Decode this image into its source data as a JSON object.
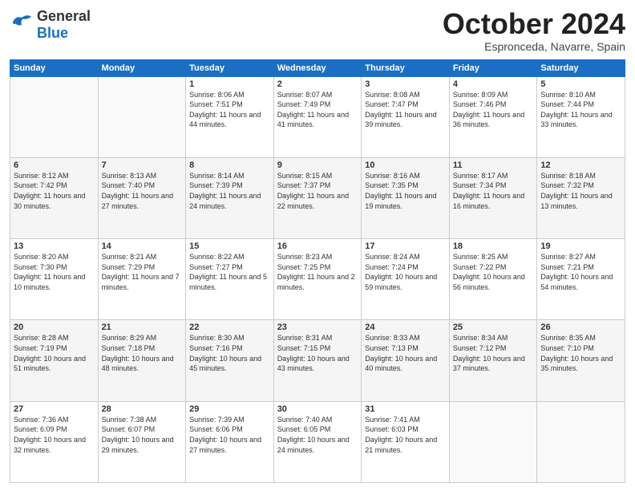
{
  "header": {
    "logo_line1": "General",
    "logo_line2": "Blue",
    "month": "October 2024",
    "location": "Espronceda, Navarre, Spain"
  },
  "days_of_week": [
    "Sunday",
    "Monday",
    "Tuesday",
    "Wednesday",
    "Thursday",
    "Friday",
    "Saturday"
  ],
  "weeks": [
    [
      {
        "day": "",
        "info": ""
      },
      {
        "day": "",
        "info": ""
      },
      {
        "day": "1",
        "info": "Sunrise: 8:06 AM\nSunset: 7:51 PM\nDaylight: 11 hours and 44 minutes."
      },
      {
        "day": "2",
        "info": "Sunrise: 8:07 AM\nSunset: 7:49 PM\nDaylight: 11 hours and 41 minutes."
      },
      {
        "day": "3",
        "info": "Sunrise: 8:08 AM\nSunset: 7:47 PM\nDaylight: 11 hours and 39 minutes."
      },
      {
        "day": "4",
        "info": "Sunrise: 8:09 AM\nSunset: 7:46 PM\nDaylight: 11 hours and 36 minutes."
      },
      {
        "day": "5",
        "info": "Sunrise: 8:10 AM\nSunset: 7:44 PM\nDaylight: 11 hours and 33 minutes."
      }
    ],
    [
      {
        "day": "6",
        "info": "Sunrise: 8:12 AM\nSunset: 7:42 PM\nDaylight: 11 hours and 30 minutes."
      },
      {
        "day": "7",
        "info": "Sunrise: 8:13 AM\nSunset: 7:40 PM\nDaylight: 11 hours and 27 minutes."
      },
      {
        "day": "8",
        "info": "Sunrise: 8:14 AM\nSunset: 7:39 PM\nDaylight: 11 hours and 24 minutes."
      },
      {
        "day": "9",
        "info": "Sunrise: 8:15 AM\nSunset: 7:37 PM\nDaylight: 11 hours and 22 minutes."
      },
      {
        "day": "10",
        "info": "Sunrise: 8:16 AM\nSunset: 7:35 PM\nDaylight: 11 hours and 19 minutes."
      },
      {
        "day": "11",
        "info": "Sunrise: 8:17 AM\nSunset: 7:34 PM\nDaylight: 11 hours and 16 minutes."
      },
      {
        "day": "12",
        "info": "Sunrise: 8:18 AM\nSunset: 7:32 PM\nDaylight: 11 hours and 13 minutes."
      }
    ],
    [
      {
        "day": "13",
        "info": "Sunrise: 8:20 AM\nSunset: 7:30 PM\nDaylight: 11 hours and 10 minutes."
      },
      {
        "day": "14",
        "info": "Sunrise: 8:21 AM\nSunset: 7:29 PM\nDaylight: 11 hours and 7 minutes."
      },
      {
        "day": "15",
        "info": "Sunrise: 8:22 AM\nSunset: 7:27 PM\nDaylight: 11 hours and 5 minutes."
      },
      {
        "day": "16",
        "info": "Sunrise: 8:23 AM\nSunset: 7:25 PM\nDaylight: 11 hours and 2 minutes."
      },
      {
        "day": "17",
        "info": "Sunrise: 8:24 AM\nSunset: 7:24 PM\nDaylight: 10 hours and 59 minutes."
      },
      {
        "day": "18",
        "info": "Sunrise: 8:25 AM\nSunset: 7:22 PM\nDaylight: 10 hours and 56 minutes."
      },
      {
        "day": "19",
        "info": "Sunrise: 8:27 AM\nSunset: 7:21 PM\nDaylight: 10 hours and 54 minutes."
      }
    ],
    [
      {
        "day": "20",
        "info": "Sunrise: 8:28 AM\nSunset: 7:19 PM\nDaylight: 10 hours and 51 minutes."
      },
      {
        "day": "21",
        "info": "Sunrise: 8:29 AM\nSunset: 7:18 PM\nDaylight: 10 hours and 48 minutes."
      },
      {
        "day": "22",
        "info": "Sunrise: 8:30 AM\nSunset: 7:16 PM\nDaylight: 10 hours and 45 minutes."
      },
      {
        "day": "23",
        "info": "Sunrise: 8:31 AM\nSunset: 7:15 PM\nDaylight: 10 hours and 43 minutes."
      },
      {
        "day": "24",
        "info": "Sunrise: 8:33 AM\nSunset: 7:13 PM\nDaylight: 10 hours and 40 minutes."
      },
      {
        "day": "25",
        "info": "Sunrise: 8:34 AM\nSunset: 7:12 PM\nDaylight: 10 hours and 37 minutes."
      },
      {
        "day": "26",
        "info": "Sunrise: 8:35 AM\nSunset: 7:10 PM\nDaylight: 10 hours and 35 minutes."
      }
    ],
    [
      {
        "day": "27",
        "info": "Sunrise: 7:36 AM\nSunset: 6:09 PM\nDaylight: 10 hours and 32 minutes."
      },
      {
        "day": "28",
        "info": "Sunrise: 7:38 AM\nSunset: 6:07 PM\nDaylight: 10 hours and 29 minutes."
      },
      {
        "day": "29",
        "info": "Sunrise: 7:39 AM\nSunset: 6:06 PM\nDaylight: 10 hours and 27 minutes."
      },
      {
        "day": "30",
        "info": "Sunrise: 7:40 AM\nSunset: 6:05 PM\nDaylight: 10 hours and 24 minutes."
      },
      {
        "day": "31",
        "info": "Sunrise: 7:41 AM\nSunset: 6:03 PM\nDaylight: 10 hours and 21 minutes."
      },
      {
        "day": "",
        "info": ""
      },
      {
        "day": "",
        "info": ""
      }
    ]
  ]
}
